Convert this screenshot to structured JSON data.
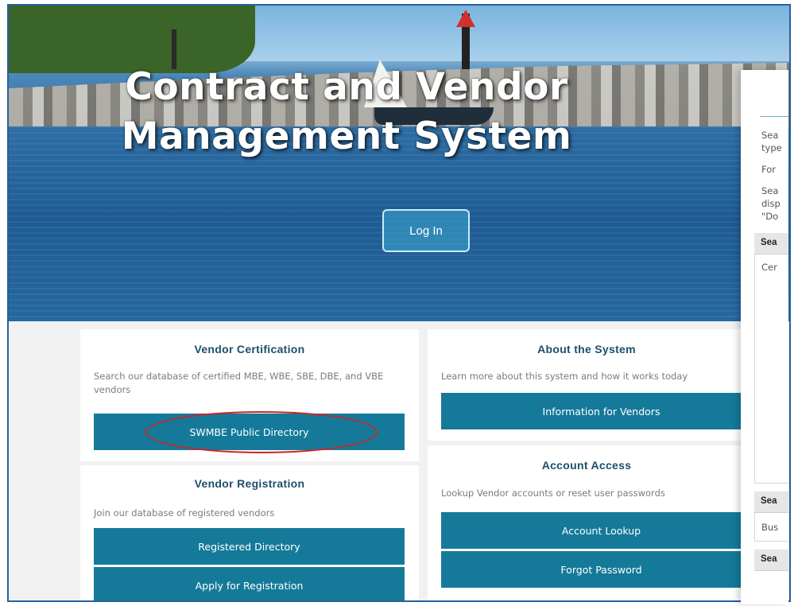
{
  "hero": {
    "title_line1": "Contract and Vendor",
    "title_line2": "Management System",
    "login_label": "Log In"
  },
  "cards": {
    "vendor_certification": {
      "title": "Vendor Certification",
      "description": "Search our database of certified MBE, WBE, SBE, DBE, and VBE vendors",
      "button": "SWMBE Public Directory"
    },
    "about_system": {
      "title": "About the System",
      "description": "Learn more about this system and how it works today",
      "button": "Information for Vendors"
    },
    "vendor_registration": {
      "title": "Vendor Registration",
      "description": "Join our database of registered vendors",
      "button_directory": "Registered Directory",
      "button_apply": "Apply for Registration"
    },
    "account_access": {
      "title": "Account Access",
      "description": "Lookup Vendor accounts or reset user passwords",
      "button_lookup": "Account Lookup",
      "button_forgot": "Forgot Password"
    }
  },
  "search_panel": {
    "lines": [
      "Sea",
      "type",
      "For",
      "Sea",
      "disp",
      "\"Do"
    ],
    "header1": "Sea",
    "item1": "Cer",
    "header2": "Sea",
    "item2": "Bus",
    "header3": "Sea"
  },
  "colors": {
    "button": "#157a99",
    "heading": "#1c4e6b",
    "highlight": "#d42222",
    "frame": "#2a5f9e"
  }
}
